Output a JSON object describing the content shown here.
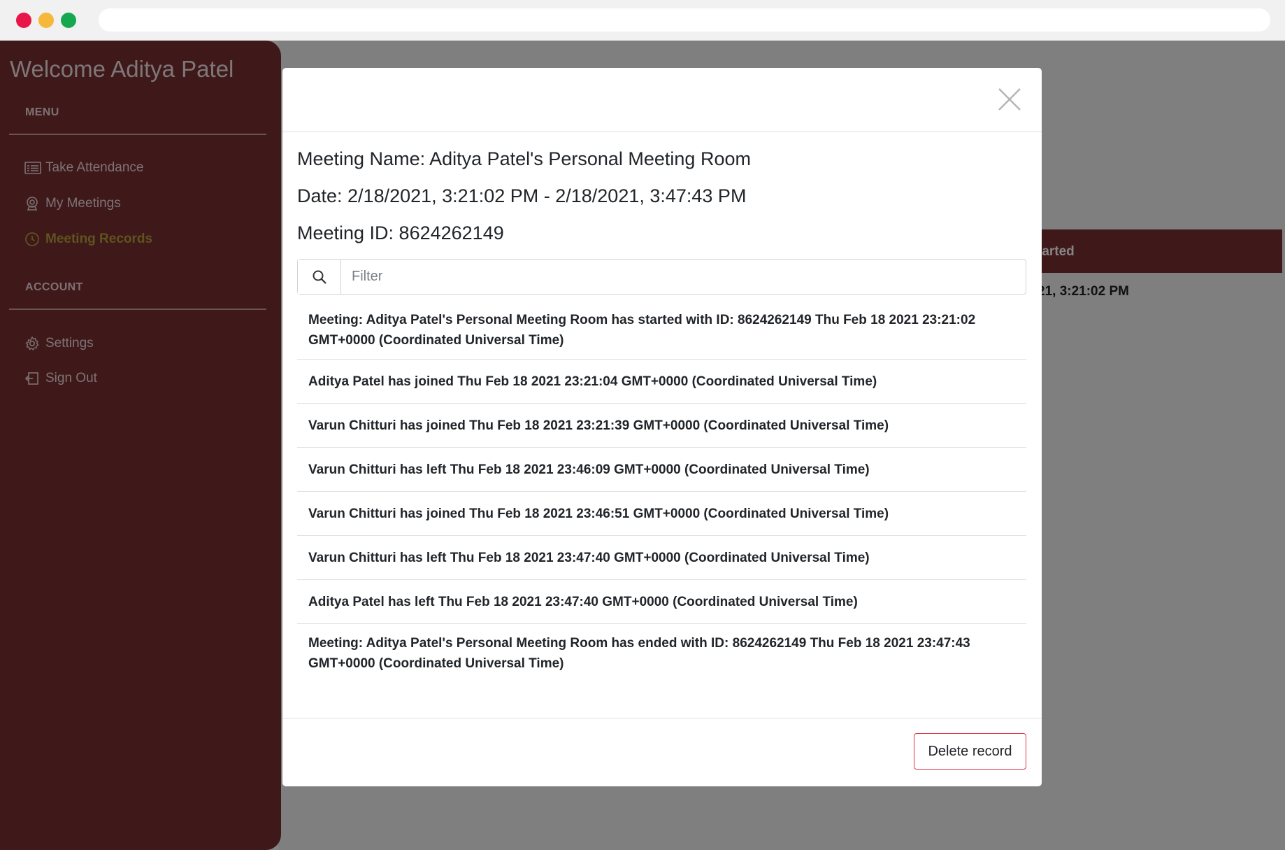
{
  "sidebar": {
    "welcome": "Welcome Aditya Patel",
    "menu_label": "MENU",
    "account_label": "ACCOUNT",
    "menu_items": [
      {
        "label": "Take Attendance",
        "icon": "list-icon"
      },
      {
        "label": "My Meetings",
        "icon": "webcam-icon"
      },
      {
        "label": "Meeting Records",
        "icon": "clock-icon",
        "active": true
      }
    ],
    "account_items": [
      {
        "label": "Settings",
        "icon": "gear-icon"
      },
      {
        "label": "Sign Out",
        "icon": "sign-out-icon"
      }
    ],
    "active_color": "#b3a23a"
  },
  "background_table": {
    "header_fragment": "tarted",
    "cell_fragment": "21, 3:21:02 PM"
  },
  "modal": {
    "meeting_name": "Meeting Name: Aditya Patel's Personal Meeting Room",
    "date": "Date: 2/18/2021, 3:21:02 PM - 2/18/2021, 3:47:43 PM",
    "meeting_id": "Meeting ID: 8624262149",
    "filter_placeholder": "Filter",
    "logs": [
      "Meeting: Aditya Patel's Personal Meeting Room has started with ID: 8624262149 Thu Feb 18 2021 23:21:02 GMT+0000 (Coordinated Universal Time)",
      "Aditya Patel has joined Thu Feb 18 2021 23:21:04 GMT+0000 (Coordinated Universal Time)",
      "Varun Chitturi has joined Thu Feb 18 2021 23:21:39 GMT+0000 (Coordinated Universal Time)",
      "Varun Chitturi has left Thu Feb 18 2021 23:46:09 GMT+0000 (Coordinated Universal Time)",
      "Varun Chitturi has joined Thu Feb 18 2021 23:46:51 GMT+0000 (Coordinated Universal Time)",
      "Varun Chitturi has left Thu Feb 18 2021 23:47:40 GMT+0000 (Coordinated Universal Time)",
      "Aditya Patel has left Thu Feb 18 2021 23:47:40 GMT+0000 (Coordinated Universal Time)",
      "Meeting: Aditya Patel's Personal Meeting Room has ended with ID: 8624262149 Thu Feb 18 2021 23:47:43 GMT+0000 (Coordinated Universal Time)"
    ],
    "delete_label": "Delete record",
    "delete_border_color": "#dc3545"
  },
  "colors": {
    "brand": "#7a2e32"
  }
}
